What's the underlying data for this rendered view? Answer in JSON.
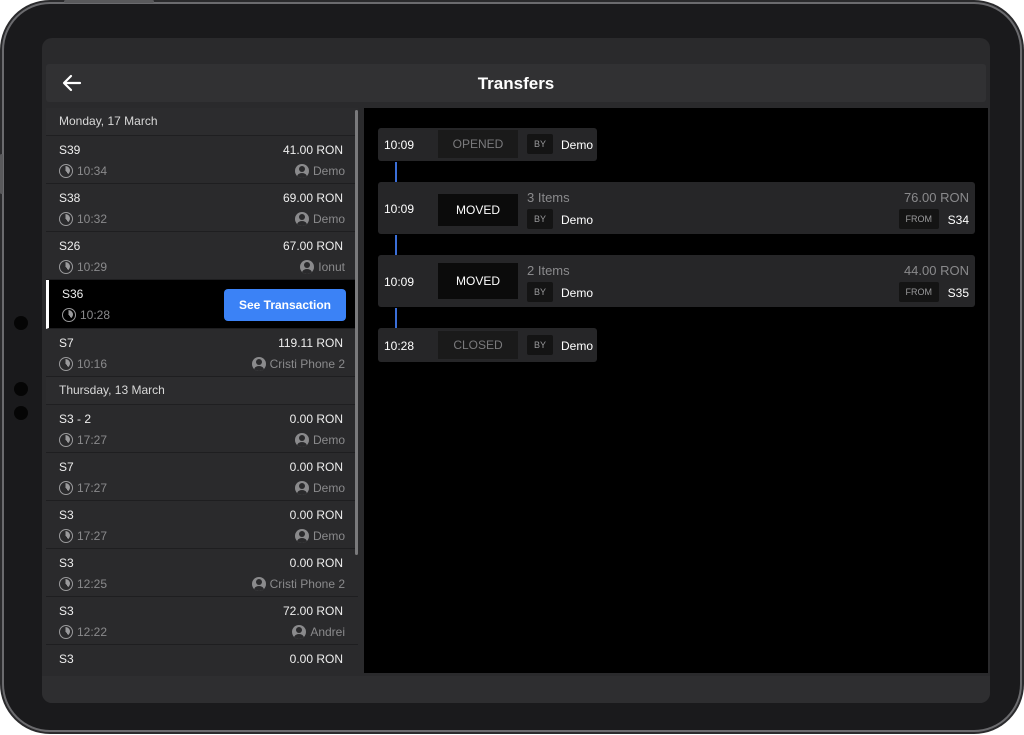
{
  "header": {
    "title": "Transfers"
  },
  "colors": {
    "accent": "#3b82f6",
    "background": "#000000",
    "panel": "#2a2a2c"
  },
  "icons": {
    "back": "arrow-left-icon",
    "clock": "clock-icon",
    "user": "user-icon"
  },
  "list": {
    "groups": [
      {
        "date": "Monday, 17 March",
        "rows": [
          {
            "code": "S39",
            "amount": "41.00 RON",
            "time": "10:34",
            "user": "Demo"
          },
          {
            "code": "S38",
            "amount": "69.00 RON",
            "time": "10:32",
            "user": "Demo"
          },
          {
            "code": "S26",
            "amount": "67.00 RON",
            "time": "10:29",
            "user": "Ionut"
          },
          {
            "code": "S36",
            "time": "10:28",
            "selected": true,
            "action": "See Transaction"
          },
          {
            "code": "S7",
            "amount": "119.11 RON",
            "time": "10:16",
            "user": "Cristi Phone 2"
          }
        ]
      },
      {
        "date": "Thursday, 13 March",
        "rows": [
          {
            "code": "S3 - 2",
            "amount": "0.00 RON",
            "time": "17:27",
            "user": "Demo"
          },
          {
            "code": "S7",
            "amount": "0.00 RON",
            "time": "17:27",
            "user": "Demo"
          },
          {
            "code": "S3",
            "amount": "0.00 RON",
            "time": "17:27",
            "user": "Demo"
          },
          {
            "code": "S3",
            "amount": "0.00 RON",
            "time": "12:25",
            "user": "Cristi Phone 2"
          },
          {
            "code": "S3",
            "amount": "72.00 RON",
            "time": "12:22",
            "user": "Andrei"
          },
          {
            "code": "S3",
            "amount": "0.00 RON",
            "time": "",
            "user": ""
          }
        ]
      }
    ]
  },
  "timeline": {
    "by_label": "BY",
    "from_label": "FROM",
    "events": [
      {
        "time": "10:09",
        "status": "OPENED",
        "by": "Demo"
      },
      {
        "time": "10:09",
        "status": "MOVED",
        "items": "3 Items",
        "amount": "76.00 RON",
        "by": "Demo",
        "from": "S34"
      },
      {
        "time": "10:09",
        "status": "MOVED",
        "items": "2 Items",
        "amount": "44.00 RON",
        "by": "Demo",
        "from": "S35"
      },
      {
        "time": "10:28",
        "status": "CLOSED",
        "by": "Demo"
      }
    ]
  }
}
